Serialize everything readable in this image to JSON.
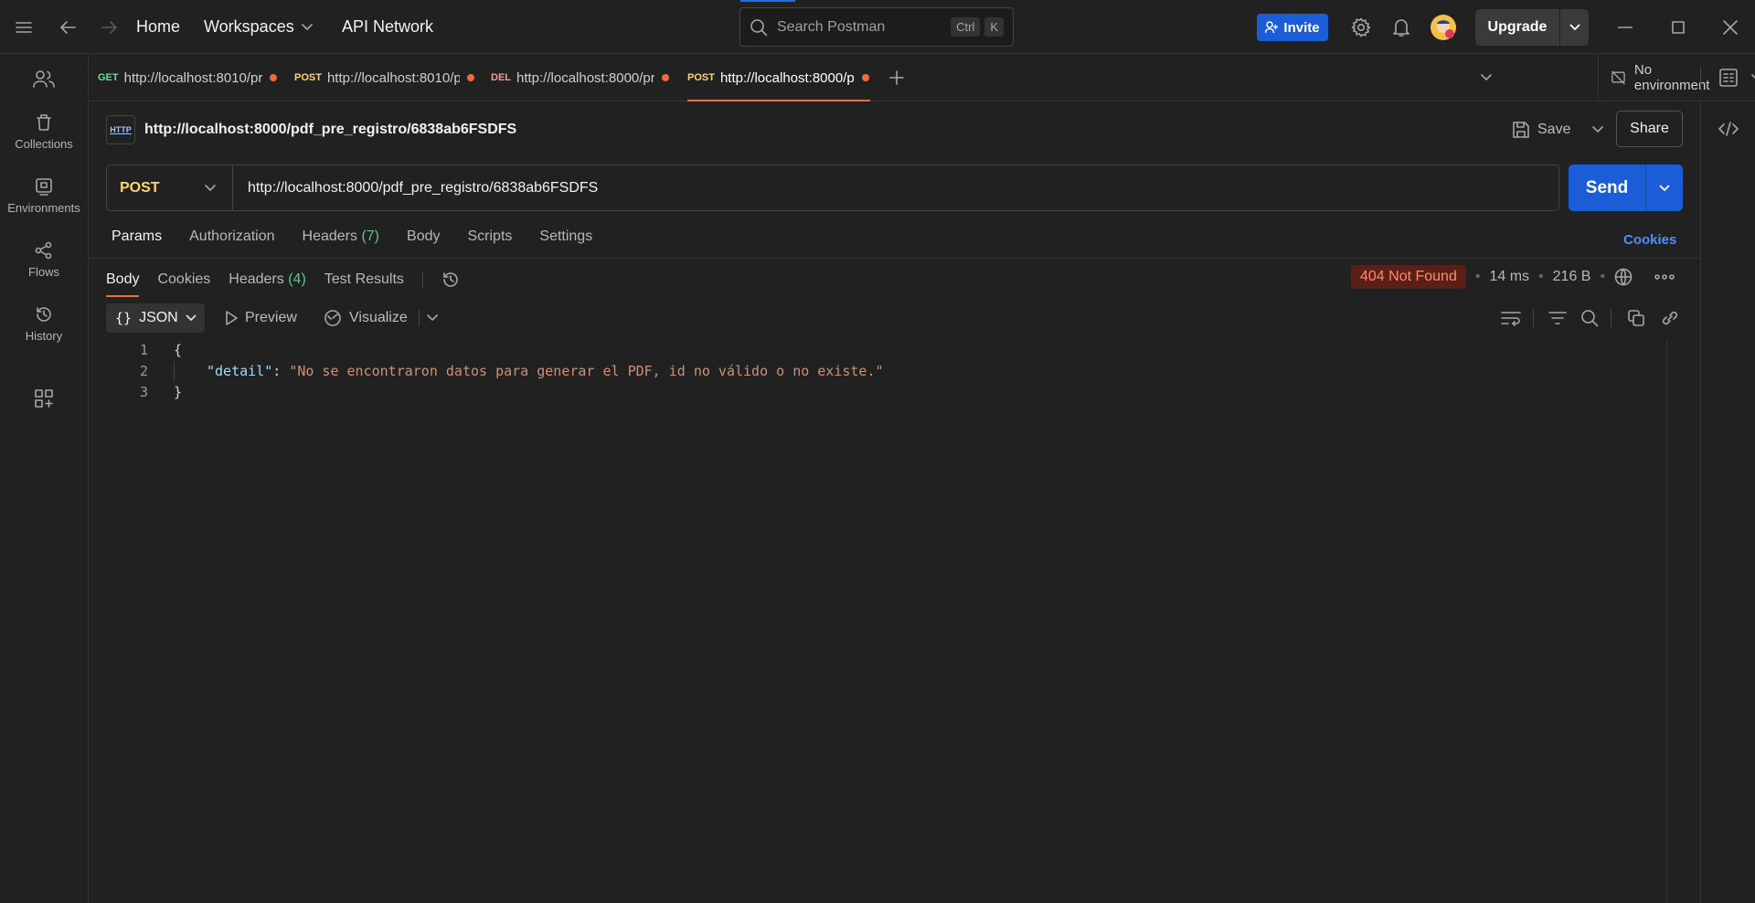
{
  "topbar": {
    "home": "Home",
    "workspaces": "Workspaces",
    "api_network": "API Network",
    "search_placeholder": "Search Postman",
    "shortcut_ctrl": "Ctrl",
    "shortcut_k": "K",
    "invite": "Invite",
    "upgrade": "Upgrade"
  },
  "sidebar": {
    "items": [
      {
        "label": "Collections",
        "icon": "trash-can-icon"
      },
      {
        "label": "Environments",
        "icon": "environment-icon"
      },
      {
        "label": "Flows",
        "icon": "flows-icon"
      },
      {
        "label": "History",
        "icon": "history-icon"
      }
    ]
  },
  "tabs": [
    {
      "method": "GET",
      "method_color": "#6bdd9a",
      "url": "http://localhost:8010/pr",
      "unsaved": true
    },
    {
      "method": "POST",
      "method_color": "#ffd66b",
      "url": "http://localhost:8010/p",
      "unsaved": true
    },
    {
      "method": "DEL",
      "method_color": "#f79a8e",
      "url": "http://localhost:8000/pr",
      "unsaved": true
    },
    {
      "method": "POST",
      "method_color": "#ffd66b",
      "url": "http://localhost:8000/p",
      "unsaved": true,
      "active": true
    }
  ],
  "environment": "No environment",
  "request": {
    "badge": "HTTP",
    "title": "http://localhost:8000/pdf_pre_registro/6838ab6FSDFS",
    "save": "Save",
    "share": "Share",
    "method": "POST",
    "url": "http://localhost:8000/pdf_pre_registro/6838ab6FSDFS",
    "send": "Send",
    "tabs": {
      "params": "Params",
      "authorization": "Authorization",
      "headers": "Headers",
      "headers_count": "(7)",
      "body": "Body",
      "scripts": "Scripts",
      "settings": "Settings"
    },
    "cookies": "Cookies"
  },
  "response": {
    "tabs": {
      "body": "Body",
      "cookies": "Cookies",
      "headers": "Headers",
      "headers_count": "(4)",
      "test_results": "Test Results"
    },
    "status": "404 Not Found",
    "time": "14 ms",
    "size": "216 B",
    "format": "JSON",
    "preview": "Preview",
    "visualize": "Visualize",
    "lines": [
      {
        "n": "1",
        "open": "{"
      },
      {
        "n": "2",
        "key": "\"detail\"",
        "colon": ": ",
        "value": "\"No se encontraron datos para generar el PDF, id no válido o no existe.\""
      },
      {
        "n": "3",
        "close": "}"
      }
    ]
  }
}
